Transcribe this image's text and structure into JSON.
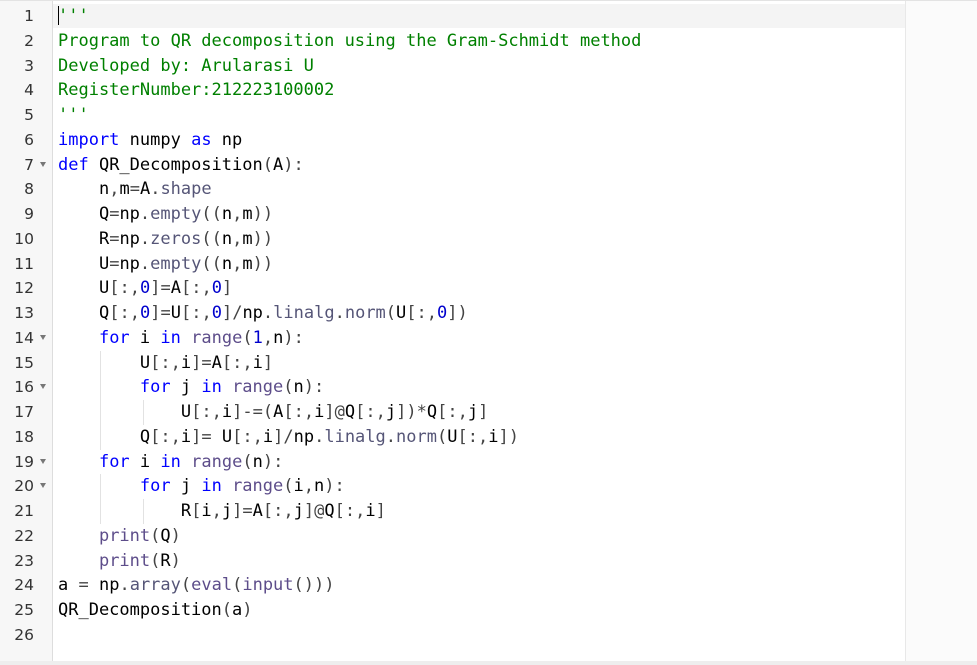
{
  "editor": {
    "lines": [
      {
        "number": "1",
        "foldable": false,
        "text": "'''"
      },
      {
        "number": "2",
        "foldable": false,
        "text": "Program to QR decomposition using the Gram-Schmidt method"
      },
      {
        "number": "3",
        "foldable": false,
        "text": "Developed by: Arularasi U"
      },
      {
        "number": "4",
        "foldable": false,
        "text": "RegisterNumber:212223100002"
      },
      {
        "number": "5",
        "foldable": false,
        "text": "'''"
      },
      {
        "number": "6",
        "foldable": false,
        "text": "import numpy as np"
      },
      {
        "number": "7",
        "foldable": true,
        "text": "def QR_Decomposition(A):"
      },
      {
        "number": "8",
        "foldable": false,
        "text": "    n,m=A.shape"
      },
      {
        "number": "9",
        "foldable": false,
        "text": "    Q=np.empty((n,m))"
      },
      {
        "number": "10",
        "foldable": false,
        "text": "    R=np.zeros((n,m))"
      },
      {
        "number": "11",
        "foldable": false,
        "text": "    U=np.empty((n,m))"
      },
      {
        "number": "12",
        "foldable": false,
        "text": "    U[:,0]=A[:,0]"
      },
      {
        "number": "13",
        "foldable": false,
        "text": "    Q[:,0]=U[:,0]/np.linalg.norm(U[:,0])"
      },
      {
        "number": "14",
        "foldable": true,
        "text": "    for i in range(1,n):"
      },
      {
        "number": "15",
        "foldable": false,
        "text": "        U[:,i]=A[:,i]"
      },
      {
        "number": "16",
        "foldable": true,
        "text": "        for j in range(n):"
      },
      {
        "number": "17",
        "foldable": false,
        "text": "            U[:,i]-=(A[:,i]@Q[:,j])*Q[:,j]"
      },
      {
        "number": "18",
        "foldable": false,
        "text": "        Q[:,i]= U[:,i]/np.linalg.norm(U[:,i])"
      },
      {
        "number": "19",
        "foldable": true,
        "text": "    for i in range(n):"
      },
      {
        "number": "20",
        "foldable": true,
        "text": "        for j in range(i,n):"
      },
      {
        "number": "21",
        "foldable": false,
        "text": "            R[i,j]=A[:,j]@Q[:,i]"
      },
      {
        "number": "22",
        "foldable": false,
        "text": "    print(Q)"
      },
      {
        "number": "23",
        "foldable": false,
        "text": "    print(R)"
      },
      {
        "number": "24",
        "foldable": false,
        "text": "a = np.array(eval(input()))"
      },
      {
        "number": "25",
        "foldable": false,
        "text": "QR_Decomposition(a)"
      },
      {
        "number": "26",
        "foldable": false,
        "text": ""
      }
    ]
  }
}
